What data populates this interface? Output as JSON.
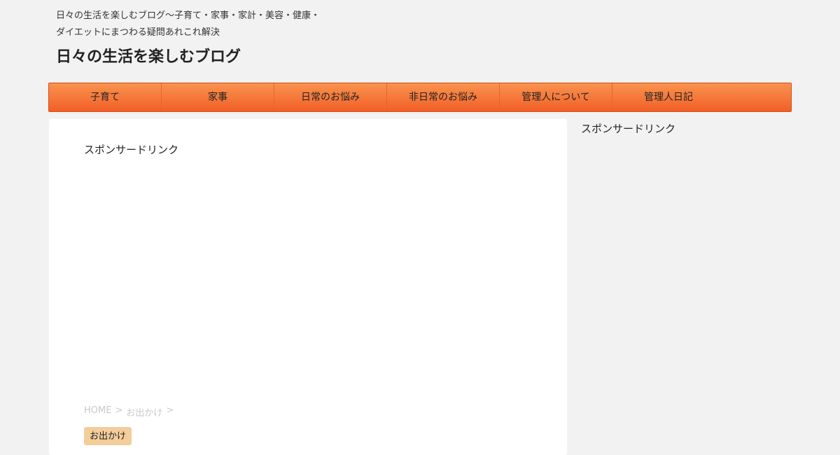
{
  "header": {
    "tagline_line1": "日々の生活を楽しむブログ～子育て・家事・家計・美容・健康・",
    "tagline_line2": "ダイエットにまつわる疑問あれこれ解決",
    "site_title": "日々の生活を楽しむブログ"
  },
  "nav": {
    "items": [
      {
        "label": "子育て"
      },
      {
        "label": "家事"
      },
      {
        "label": "日常のお悩み"
      },
      {
        "label": "非日常のお悩み"
      },
      {
        "label": "管理人について"
      },
      {
        "label": "管理人日記"
      }
    ]
  },
  "main": {
    "sponsor_label": "スポンサードリンク",
    "breadcrumb": {
      "home": "HOME",
      "category": "お出かけ",
      "separator": ">"
    },
    "category_badge": "お出かけ"
  },
  "sidebar": {
    "sponsor_label": "スポンサードリンク"
  },
  "colors": {
    "nav_gradient_top": "#f9934f",
    "nav_gradient_bottom": "#f15f27",
    "badge": "#f3cd9a",
    "page_background": "#f2f2f2"
  }
}
